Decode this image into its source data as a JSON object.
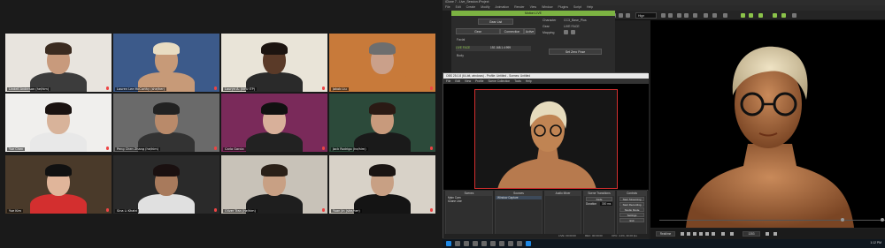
{
  "participants": [
    {
      "name": "Lindell Anderson (he/him)",
      "bg": "#e8e4de",
      "skin": "#c89a7c",
      "hair": "#3b2b20",
      "shirt": "#3c3c3c"
    },
    {
      "name": "Lauren Lee McCarthy (she/her)",
      "bg": "#3c5a8a",
      "skin": "#c79a78",
      "hair": "#e8dcc2",
      "shirt": "#c79a78"
    },
    {
      "name": "Lauryn A. (NYU ITP)",
      "bg": "#e9e4d8",
      "skin": "#5a3a28",
      "hair": "#1c1410",
      "shirt": "#2a2a2a"
    },
    {
      "name": "Jakob Liu",
      "bg": "#c87a3a",
      "skin": "#caa08a",
      "hair": "#6e6e6e",
      "shirt": "#c87a3a"
    },
    {
      "name": "Yue Chen",
      "bg": "#f0efed",
      "skin": "#d8b39a",
      "hair": "#1a1210",
      "shirt": "#e8e8e8"
    },
    {
      "name": "Peng Chen Zhang (he/him)",
      "bg": "#6a6a6a",
      "skin": "#b98a6a",
      "hair": "#222",
      "shirt": "#333"
    },
    {
      "name": "Carla Garcia",
      "bg": "#7a2a5a",
      "skin": "#d8b09a",
      "hair": "#111",
      "shirt": "#222"
    },
    {
      "name": "Jack Rodrigo (he/him)",
      "bg": "#2c4a3a",
      "skin": "#c89a7c",
      "hair": "#2a1a14",
      "shirt": "#1a1a1a"
    },
    {
      "name": "Yue Kim",
      "bg": "#4a3a2a",
      "skin": "#e0b59a",
      "hair": "#111",
      "shirt": "#d32f2f"
    },
    {
      "name": "Sina Li Khatri",
      "bg": "#2a2a2a",
      "skin": "#a87a5c",
      "hair": "#1a1010",
      "shirt": "#e0e0e0"
    },
    {
      "name": "Oliver Tran (he/him)",
      "bg": "#c8c2b8",
      "skin": "#c8a084",
      "hair": "#2a2018",
      "shirt": "#1e1e1e"
    },
    {
      "name": "Yuan Jin (she/her)",
      "bg": "#d8d2c8",
      "skin": "#c8a084",
      "hair": "#1a1412",
      "shirt": "#141414"
    }
  ],
  "desktop": {
    "menu": [
      "File",
      "Edit",
      "Create",
      "Modify",
      "Animation",
      "Render",
      "View",
      "Window",
      "Plugins",
      "Script",
      "Help"
    ],
    "app_title": "iClone 7 - Live_Session.iProject",
    "toolbar_select": "Hige"
  },
  "mlive": {
    "header": "Motion LIVE",
    "status_label": "Gear List",
    "col_headers": [
      "Gear",
      "Connection",
      "Active"
    ],
    "character_label": "Character",
    "character_value": "CC3_Base_Plus",
    "gear_label": "Gear",
    "gear_value": "LIVE FACE",
    "mapping_label": "Mapping",
    "device_row": "LIVE FACE",
    "device_ip": "192.168.1.4:999",
    "group_label": "Facial",
    "body_label": "Body",
    "set_button": "Set Zero Pose"
  },
  "obs": {
    "title": "OBS 25.0.8 (64-bit, windows) - Profile: Untitled - Scenes: Untitled",
    "menu": [
      "File",
      "Edit",
      "View",
      "Profile",
      "Scene Collection",
      "Tools",
      "Help"
    ],
    "docks": {
      "scenes": {
        "header": "Scenes",
        "items": [
          "Main Cam",
          "iClone Live"
        ]
      },
      "sources": {
        "header": "Sources",
        "items": [
          "Window Capture"
        ]
      },
      "mixer": {
        "header": "Audio Mixer"
      },
      "transitions": {
        "header": "Scene Transitions",
        "select": "Fade",
        "duration_label": "Duration",
        "duration_value": "300 ms"
      },
      "controls": {
        "header": "Controls",
        "buttons": [
          "Start Streaming",
          "Start Recording",
          "Studio Mode",
          "Settings",
          "Exit"
        ]
      }
    },
    "status": {
      "live": "LIVE: 00:00:00",
      "rec": "REC: 00:00:00",
      "cpu": "CPU: 4.2%, 30.00 fps"
    }
  },
  "playbar": {
    "realtime_label": "Realtime",
    "frame_value": "1353"
  },
  "taskbar": {
    "clock": "1:12 PM"
  },
  "colors": {
    "accent_green": "#8bc34a",
    "obs_red_border": "#d32f2f"
  }
}
